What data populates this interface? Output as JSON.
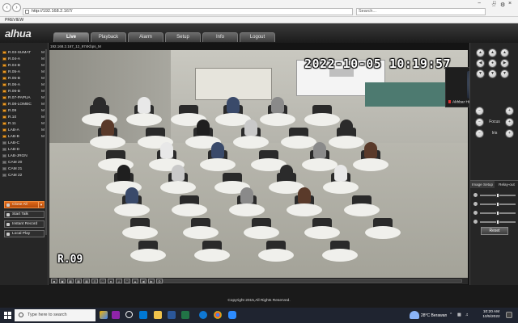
{
  "browser": {
    "url": "http://192.168.2.167/",
    "search_placeholder": "Search...",
    "tab_title": "PREVIEW",
    "window_controls": [
      "−",
      "□",
      "×"
    ]
  },
  "app": {
    "logo": "alhua",
    "menu": [
      "Live",
      "Playback",
      "Alarm",
      "Setup",
      "Info",
      "Logout"
    ],
    "active_menu": "Live"
  },
  "channels": [
    {
      "name": "R.03-SUMAT",
      "flag": "M",
      "on": true
    },
    {
      "name": "R.04-A",
      "flag": "M",
      "on": true
    },
    {
      "name": "R.04-B",
      "flag": "M",
      "on": true
    },
    {
      "name": "R.05-A",
      "flag": "M",
      "on": true
    },
    {
      "name": "R.05-B",
      "flag": "M",
      "on": true
    },
    {
      "name": "R.06-A",
      "flag": "M",
      "on": true
    },
    {
      "name": "R.06-B",
      "flag": "M",
      "on": true
    },
    {
      "name": "R.07-PAPUA",
      "flag": "M",
      "on": true
    },
    {
      "name": "R.08-LOMBC",
      "flag": "M",
      "on": true
    },
    {
      "name": "R.09",
      "flag": "M",
      "on": true
    },
    {
      "name": "R.10",
      "flag": "M",
      "on": true
    },
    {
      "name": "R.11",
      "flag": "M",
      "on": true
    },
    {
      "name": "LAB-A",
      "flag": "M",
      "on": true
    },
    {
      "name": "LAB-B",
      "flag": "M",
      "on": true
    },
    {
      "name": "LAB-C",
      "flag": "",
      "on": false
    },
    {
      "name": "LAB-D",
      "flag": "",
      "on": false
    },
    {
      "name": "LAB-JRGN",
      "flag": "",
      "on": false
    },
    {
      "name": "CAM 20",
      "flag": "",
      "on": false
    },
    {
      "name": "CAM 21",
      "flag": "",
      "on": false
    },
    {
      "name": "CAM 22",
      "flag": "",
      "on": false
    }
  ],
  "side_buttons": {
    "close_all": "Close All",
    "start_talk": "Start Talk",
    "instant_record": "Instant Record",
    "local_play": "Local Play"
  },
  "video": {
    "osd_info": "192.168.2.167_12_974Kbps_M",
    "timestamp": "2022-10-05 10:19:57",
    "camera_name": "R.09"
  },
  "meeting": {
    "participant": "Akhbar Hidayat"
  },
  "ptz": {
    "focus_label": "Focus",
    "iris_label": "Iris",
    "image_setup": "Image Setup",
    "relay_out": "Relay-out",
    "reset": "Reset",
    "sliders": [
      0.45,
      0.45,
      0.45,
      0.45
    ]
  },
  "footer": {
    "copyright": "Copyright 2015,All Rights Reserved."
  },
  "taskbar": {
    "search_text": "Type here to search",
    "weather": "28°C Berawan",
    "time": "10:20 AM",
    "date": "10/5/2022"
  }
}
